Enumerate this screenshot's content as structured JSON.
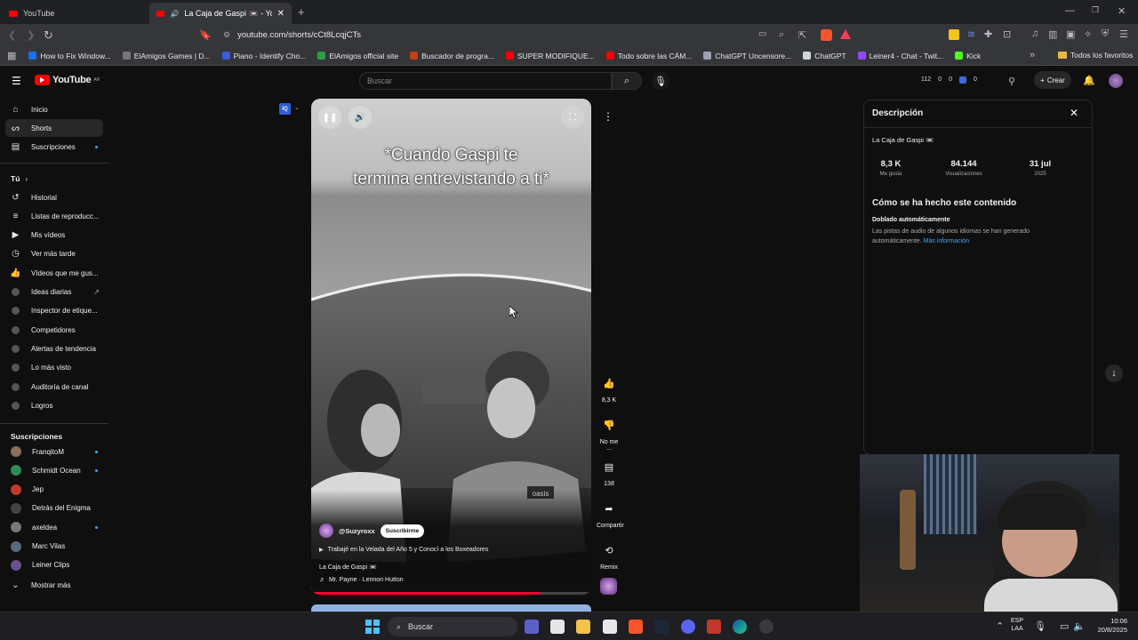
{
  "browser": {
    "tabs": [
      {
        "title": "YouTube",
        "active": false
      },
      {
        "title": "La Caja de Gaspi 📼 - YouTub",
        "active": true
      }
    ],
    "new_tab": "+",
    "url": "youtube.com/shorts/cCt8LcqjCTs",
    "bookmarks": [
      {
        "label": "How to Fix Window...",
        "color": "#1a73e8"
      },
      {
        "label": "ElAmigos Games | D...",
        "color": "#777777"
      },
      {
        "label": "Piano - Identify Cho...",
        "color": "#3b5bdb"
      },
      {
        "label": "ElAmigos official site",
        "color": "#2f9e44"
      },
      {
        "label": "Buscador de progra...",
        "color": "#c2410c"
      },
      {
        "label": "SUPER MODIFIQUE...",
        "color": "#ff0000"
      },
      {
        "label": "Todo sobre las CÁM...",
        "color": "#ff0000"
      },
      {
        "label": "ChatGPT Uncensore...",
        "color": "#9ca3af"
      },
      {
        "label": "ChatGPT",
        "color": "#d1d5db"
      },
      {
        "label": "Leiner4 - Chat - Twit...",
        "color": "#9146ff"
      },
      {
        "label": "Kick",
        "color": "#53fc18"
      }
    ],
    "all_bookmarks": "Todos los favoritos"
  },
  "yt": {
    "logo": "YouTube",
    "region": "AR",
    "search_placeholder": "Buscar",
    "stats": [
      "112",
      "0",
      "0",
      "0"
    ],
    "create": "Crear"
  },
  "sidebar": {
    "main": [
      {
        "label": "Inicio",
        "icon": "home-icon",
        "active": false
      },
      {
        "label": "Shorts",
        "icon": "shorts-icon",
        "active": true
      },
      {
        "label": "Suscripciones",
        "icon": "subscriptions-icon",
        "active": false
      }
    ],
    "you": "Tú",
    "you_items": [
      {
        "label": "Historial",
        "icon": "history-icon"
      },
      {
        "label": "Listas de reproducc...",
        "icon": "playlist-icon"
      },
      {
        "label": "Mis vídeos",
        "icon": "video-icon"
      },
      {
        "label": "Ver más tarde",
        "icon": "clock-icon"
      },
      {
        "label": "Vídeos que me gus...",
        "icon": "like-icon"
      },
      {
        "label": "Ideas diarias",
        "icon": "ideas-icon"
      },
      {
        "label": "Inspector de etique...",
        "icon": "tag-inspector-icon"
      },
      {
        "label": "Competidores",
        "icon": "competitors-icon"
      },
      {
        "label": "Alertas de tendencia",
        "icon": "trend-alert-icon"
      },
      {
        "label": "Lo más visto",
        "icon": "most-viewed-icon"
      },
      {
        "label": "Auditoría de canal",
        "icon": "audit-icon"
      },
      {
        "label": "Logros",
        "icon": "achievements-icon"
      }
    ],
    "subs_title": "Suscripciones",
    "subs": [
      {
        "label": "FranqitoM",
        "color": "#8a6d5a",
        "dot": true
      },
      {
        "label": "Schmidt Ocean",
        "color": "#2e8b57",
        "dot": true
      },
      {
        "label": "Jep",
        "color": "#c0392b",
        "dot": false
      },
      {
        "label": "Detrás del Enigma",
        "color": "#444444",
        "dot": false
      },
      {
        "label": "axeldea",
        "color": "#777777",
        "dot": true
      },
      {
        "label": "Marc Vilas",
        "color": "#5a6b7c",
        "dot": false
      },
      {
        "label": "Leiner Clips",
        "color": "#6b4f8a",
        "dot": false
      }
    ],
    "show_more": "Mostrar más"
  },
  "short": {
    "caption_line1": "*Cuando Gaspi te",
    "caption_line2": "termina entrevistando a ti*",
    "shirt_text": "oasis",
    "channel": "@Suzyroxx",
    "subscribe": "Suscribirme",
    "playlist": "Trabajé en la Velada del Año 5 y Conocí a los Boxeadores",
    "source_channel": "La Caja de Gaspi 📼",
    "music": "Mr. Payne · Lennon Hutton",
    "progress": 0.82
  },
  "actions": [
    {
      "label": "8,3 K",
      "icon": "thumbs-up-icon",
      "glyph": "👍"
    },
    {
      "label": "No me ...",
      "icon": "thumbs-down-icon",
      "glyph": "👎"
    },
    {
      "label": "138",
      "icon": "comments-icon",
      "glyph": "▤"
    },
    {
      "label": "Compartir",
      "icon": "share-icon",
      "glyph": "➦"
    },
    {
      "label": "Remix",
      "icon": "remix-icon",
      "glyph": "⟲"
    }
  ],
  "description": {
    "title": "Descripción",
    "channel": "La Caja de Gaspi 📼",
    "stats": [
      {
        "value": "8,3 K",
        "label": "Me gusta"
      },
      {
        "value": "84.144",
        "label": "Visualizaciones"
      },
      {
        "value": "31 jul",
        "label": "2025"
      }
    ],
    "how_title": "Cómo se ha hecho este contenido",
    "dub_title": "Doblado automáticamente",
    "dub_text": "Las pistas de audio de algunos idiomas se han generado automáticamente.",
    "more_info": "Más información"
  },
  "taskbar": {
    "search": "Buscar",
    "lang1": "ESP",
    "lang2": "LAA",
    "time": "10:06",
    "date": "20/8/2025"
  },
  "colors": {
    "accent": "#ff0000",
    "link": "#3ea6ff"
  }
}
